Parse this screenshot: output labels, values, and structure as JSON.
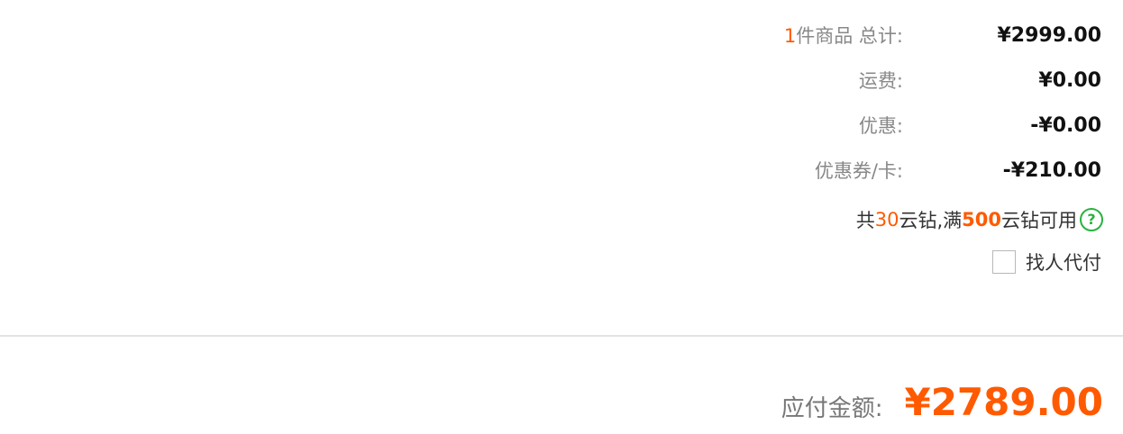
{
  "summary": {
    "item_count": "1",
    "total_label": "件商品  总计:",
    "total_value": "¥2999.00",
    "shipping_label": "运费:",
    "shipping_value": "¥0.00",
    "discount_label": "优惠:",
    "discount_value": "-¥0.00",
    "coupon_label": "优惠券/卡:",
    "coupon_value": "-¥210.00"
  },
  "yunzuan": {
    "prefix": "共 ",
    "balance": "30",
    "middle": "云钻,满 ",
    "threshold": "500",
    "suffix": " 云钻可用",
    "help_glyph": "?"
  },
  "proxy_pay": {
    "label": "找人代付",
    "checked": false
  },
  "payable": {
    "label": "应付金额:",
    "amount": "¥2789.00"
  },
  "colors": {
    "accent": "#ff5a00",
    "help_green": "#29b33f",
    "divider": "#e3e3e3"
  }
}
